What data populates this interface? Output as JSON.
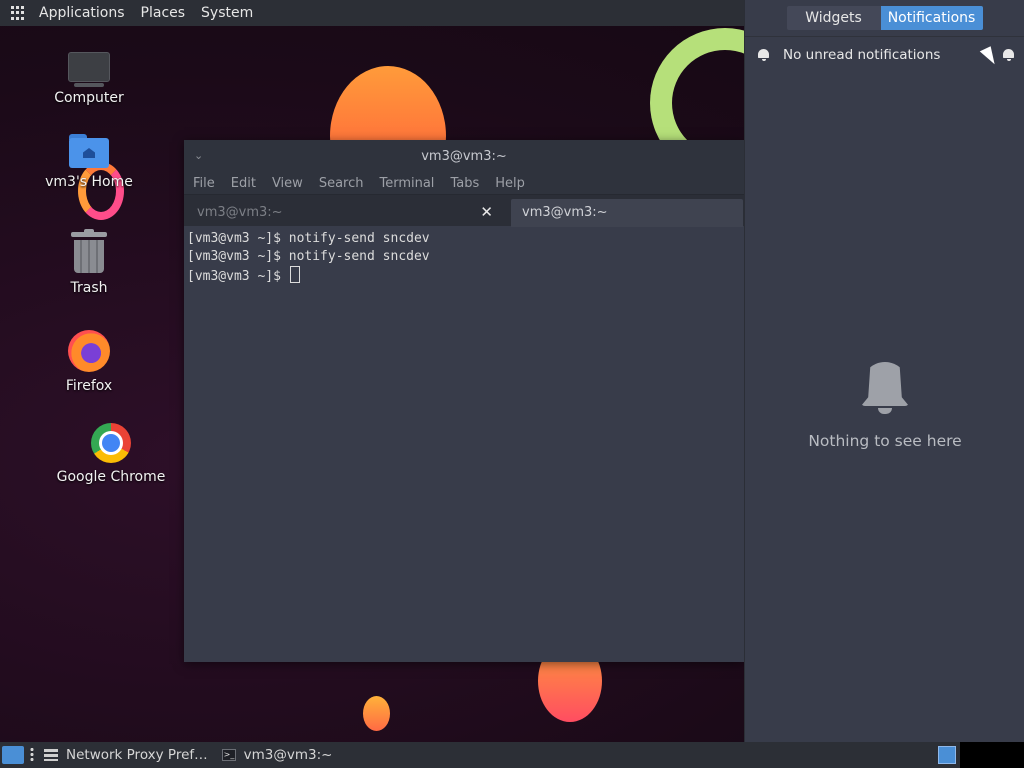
{
  "top_panel": {
    "menus": [
      "Applications",
      "Places",
      "System"
    ]
  },
  "desktop": {
    "icons": [
      {
        "label": "Computer",
        "icon": "computer-icon"
      },
      {
        "label": "vm3's Home",
        "icon": "home-folder-icon"
      },
      {
        "label": "Trash",
        "icon": "trash-icon"
      },
      {
        "label": "Firefox",
        "icon": "firefox-icon"
      },
      {
        "label": "Google Chrome",
        "icon": "chrome-icon"
      }
    ]
  },
  "terminal": {
    "title": "vm3@vm3:~",
    "menu": [
      "File",
      "Edit",
      "View",
      "Search",
      "Terminal",
      "Tabs",
      "Help"
    ],
    "tabs": [
      {
        "label": "vm3@vm3:~",
        "active": false
      },
      {
        "label": "vm3@vm3:~",
        "active": true
      }
    ],
    "lines": [
      "[vm3@vm3 ~]$ notify-send sncdev",
      "[vm3@vm3 ~]$ notify-send sncdev",
      "[vm3@vm3 ~]$ "
    ]
  },
  "notifications_panel": {
    "tabs": {
      "widgets": "Widgets",
      "notifications": "Notifications"
    },
    "header": "No unread notifications",
    "empty_text": "Nothing to see here",
    "accent": "#4a8fd6"
  },
  "taskbar": {
    "tasks": [
      {
        "label": "Network Proxy Pref…",
        "icon": "network-icon"
      },
      {
        "label": "vm3@vm3:~",
        "icon": "terminal-icon"
      }
    ]
  }
}
